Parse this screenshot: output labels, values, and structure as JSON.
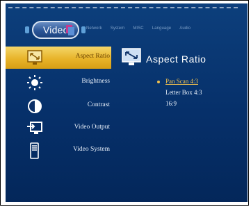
{
  "header": {
    "current_tab": "Video",
    "tabs": [
      "Network",
      "System",
      "MISC",
      "Language",
      "Audio"
    ]
  },
  "sidebar": {
    "items": [
      {
        "label": "Aspect Ratio",
        "icon": "aspect-ratio-icon",
        "active": true
      },
      {
        "label": "Brightness",
        "icon": "brightness-icon",
        "active": false
      },
      {
        "label": "Contrast",
        "icon": "contrast-icon",
        "active": false
      },
      {
        "label": "Video Output",
        "icon": "video-output-icon",
        "active": false
      },
      {
        "label": "Video System",
        "icon": "video-system-icon",
        "active": false
      }
    ]
  },
  "panel": {
    "title": "Aspect Ratio",
    "options": [
      {
        "label": "Pan Scan 4:3",
        "selected": true
      },
      {
        "label": "Letter Box 4:3",
        "selected": false
      },
      {
        "label": "16:9",
        "selected": false
      }
    ]
  },
  "colors": {
    "background": "#06306a",
    "highlight": "#e8b42a",
    "selected_text": "#f2c14e"
  }
}
